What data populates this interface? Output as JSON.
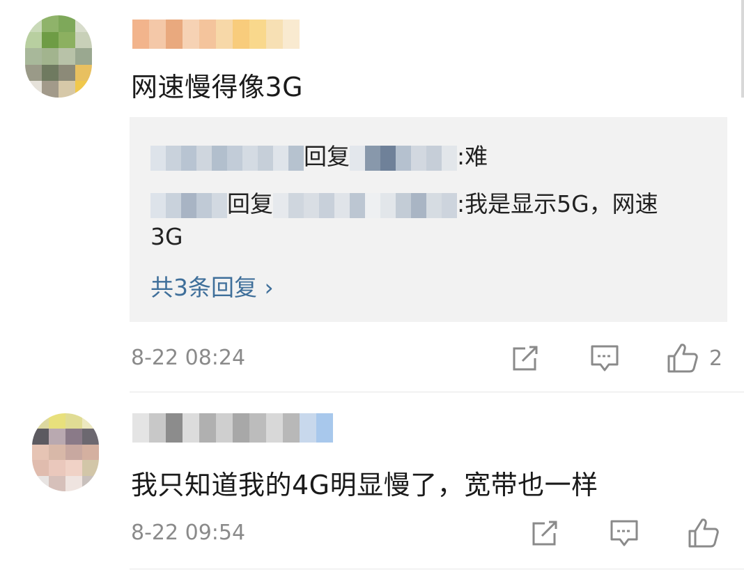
{
  "comments": [
    {
      "text": "网速慢得像3G",
      "time": "8-22 08:24",
      "like_count": "2",
      "replies": [
        {
          "reply_word": "回复",
          "text": ":难"
        },
        {
          "reply_word": "回复",
          "text": ":我是显示5G，网速",
          "text_cont": "3G"
        }
      ],
      "more_replies": "共3条回复 ›"
    },
    {
      "text": "我只知道我的4G明显慢了，宽带也一样",
      "time": "8-22 09:54"
    }
  ],
  "icons": {
    "share": "share-icon",
    "comment": "comment-icon",
    "like": "thumbs-up-icon"
  },
  "colors": {
    "link": "#3f6f9a",
    "meta": "#8a8a8a",
    "reply_bg": "#f2f2f2"
  }
}
